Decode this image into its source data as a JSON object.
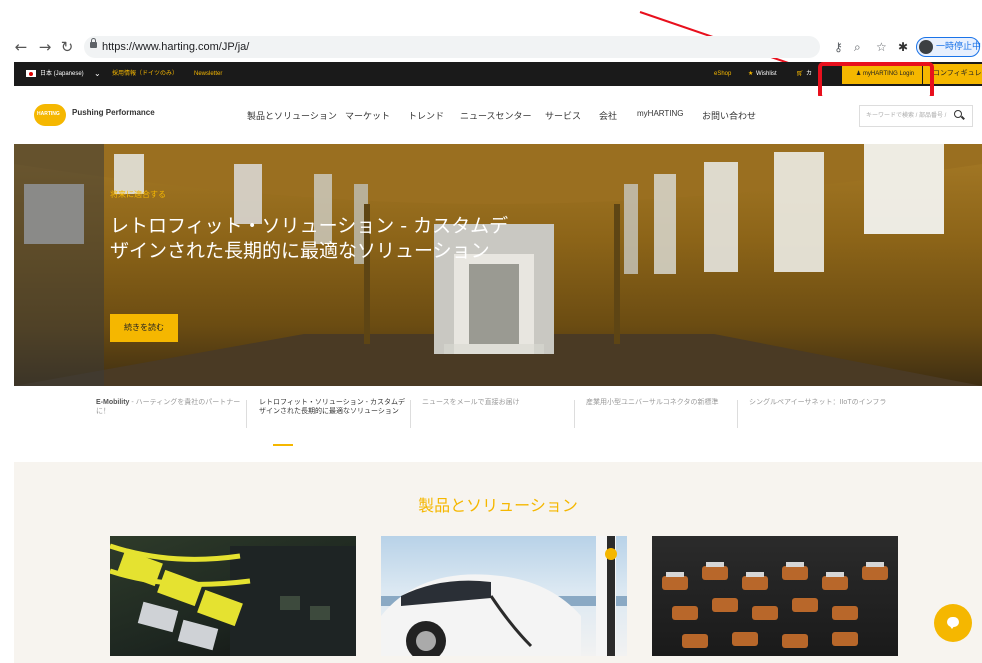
{
  "browser": {
    "url": "https://www.harting.com/JP/ja/",
    "pause_label": "一時停止中",
    "icons": [
      "back-icon",
      "forward-icon",
      "reload-icon",
      "lock-icon",
      "key-icon",
      "zoom-icon",
      "star-icon",
      "extensions-icon"
    ]
  },
  "top_bar": {
    "language": "日本 (Japanese)",
    "delivery": "採用情報（ドイツのみ）",
    "newsletter": "Newsletter",
    "eshop": "eShop",
    "wishlist": "Wishlist",
    "cart": "カ",
    "login": "myHARTING Login",
    "configurator": "コンフィギュレータ"
  },
  "header": {
    "logo_text": "HARTING",
    "tagline": "Pushing Performance",
    "nav": [
      "製品とソリューション",
      "マーケット",
      "トレンド",
      "ニュースセンター",
      "サービス",
      "会社",
      "myHARTING",
      "お問い合わせ"
    ],
    "search_placeholder": "キーワードで検索 / 部品番号 /"
  },
  "hero": {
    "eyebrow": "将来に適合する",
    "title": "レトロフィット・ソリューション - カスタムデザインされた長期的に最適なソリューション",
    "button": "続きを読む"
  },
  "teasers": [
    {
      "bold": "E-Mobility",
      "text": " - ハーティングを貴社のパートナーに！"
    },
    {
      "bold": "",
      "text": "レトロフィット・ソリューション - カスタムデザインされた長期的に最適なソリューション"
    },
    {
      "bold": "",
      "text": "ニュースをメールで直接お届け"
    },
    {
      "bold": "",
      "text": "産業用小型ユニバーサルコネクタの新標準"
    },
    {
      "bold": "",
      "text": "シングルペアイーサネット：IIoTのインフラ"
    }
  ],
  "products": {
    "title": "製品とソリューション"
  },
  "colors": {
    "brand_yellow": "#f5b700",
    "annotation_red": "#e8101d",
    "top_bar": "#1a1a1a"
  }
}
